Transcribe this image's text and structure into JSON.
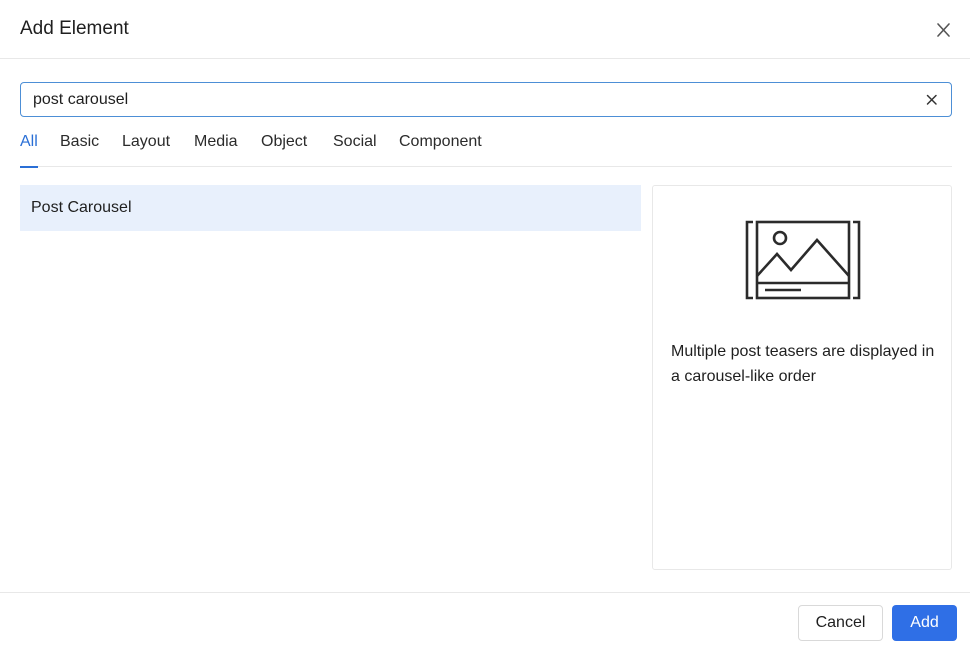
{
  "dialog": {
    "title": "Add Element",
    "close_icon": "close-icon"
  },
  "search": {
    "value": "post carousel",
    "placeholder": "",
    "clear_icon": "clear-icon"
  },
  "tabs": [
    {
      "label": "All",
      "active": true
    },
    {
      "label": "Basic",
      "active": false
    },
    {
      "label": "Layout",
      "active": false
    },
    {
      "label": "Media",
      "active": false
    },
    {
      "label": "Object",
      "active": false
    },
    {
      "label": "Social",
      "active": false
    },
    {
      "label": "Component",
      "active": false
    }
  ],
  "results": [
    {
      "label": "Post Carousel",
      "selected": true
    }
  ],
  "preview": {
    "icon": "image-carousel-icon",
    "description": "Multiple post teasers are displayed in a carousel-like order"
  },
  "footer": {
    "cancel_label": "Cancel",
    "add_label": "Add"
  },
  "colors": {
    "accent": "#2a6fd6",
    "primary_button": "#2f6fe6",
    "selected_row": "#e8f0fc",
    "search_border": "#4d8fd6"
  }
}
